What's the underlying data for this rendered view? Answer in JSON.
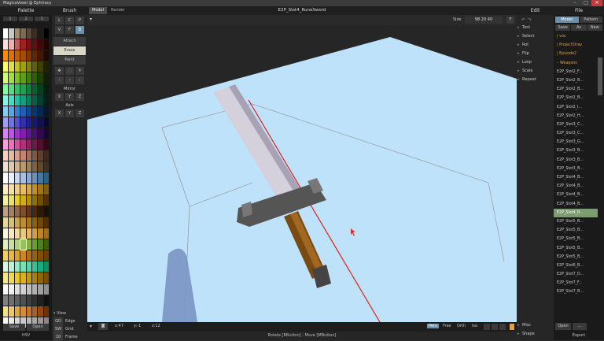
{
  "window": {
    "title": "MagicaVoxel @ Ephtracy",
    "controls": [
      "–",
      "□",
      "✕"
    ]
  },
  "palette": {
    "header": "Palette",
    "tabs": [
      "1",
      "2",
      "3"
    ],
    "save_label": "Save",
    "open_label": "Open",
    "footer": "HSV",
    "selected_index": "swatch selected",
    "colors": [
      "#ffffff",
      "#c8c8c8",
      "#a08c6c",
      "#7a6a56",
      "#584838",
      "#3a2e24",
      "#1e1a14",
      "#000000",
      "#ffe0e0",
      "#f0b0b0",
      "#c06060",
      "#a02020",
      "#801010",
      "#601010",
      "#400808",
      "#200404",
      "#ff8c00",
      "#e07000",
      "#c06000",
      "#a05000",
      "#803800",
      "#602800",
      "#401800",
      "#200800",
      "#ffff70",
      "#e0e040",
      "#c0c020",
      "#a0a010",
      "#808010",
      "#606008",
      "#404004",
      "#202000",
      "#d0ff70",
      "#a0e040",
      "#80c020",
      "#60a010",
      "#408008",
      "#306004",
      "#204000",
      "#102000",
      "#80ffa0",
      "#50e080",
      "#30c060",
      "#20a050",
      "#108040",
      "#086030",
      "#044020",
      "#022010",
      "#80ffe0",
      "#40e0c0",
      "#20c0a0",
      "#10a080",
      "#088060",
      "#066048",
      "#044030",
      "#022018",
      "#80d0ff",
      "#50a8f0",
      "#3080d0",
      "#2060b0",
      "#104890",
      "#083870",
      "#042850",
      "#021830",
      "#a0a0ff",
      "#7070f0",
      "#5050d0",
      "#3030b0",
      "#202090",
      "#181870",
      "#101050",
      "#080830",
      "#e080ff",
      "#c050f0",
      "#a030d0",
      "#8020b0",
      "#601890",
      "#481070",
      "#300850",
      "#180430",
      "#ffa0e0",
      "#f070c0",
      "#d050a0",
      "#b03080",
      "#902060",
      "#701848",
      "#501030",
      "#300818",
      "#f8d0c0",
      "#e8b8a0",
      "#d8a088",
      "#c08870",
      "#a07058",
      "#805840",
      "#604030",
      "#402820",
      "#f0e0d0",
      "#e0c8b0",
      "#d0b090",
      "#b89870",
      "#a08058",
      "#806040",
      "#604830",
      "#403020",
      "#ffffff",
      "#e8f0ff",
      "#c8d8f0",
      "#a8c0e0",
      "#88a8d0",
      "#6890c0",
      "#4878a0",
      "#306080",
      "#fff0c0",
      "#f8e0a0",
      "#f0d080",
      "#e8c060",
      "#d8a840",
      "#c09028",
      "#a07818",
      "#806010",
      "#f8f0a0",
      "#f0e060",
      "#e8d020",
      "#d0b010",
      "#b09008",
      "#907004",
      "#705002",
      "#503000",
      "#c0a080",
      "#a88060",
      "#906848",
      "#785030",
      "#603820",
      "#482810",
      "#301808",
      "#181000",
      "#e8d8a0",
      "#d8c070",
      "#c8a850",
      "#b89030",
      "#a07820",
      "#886010",
      "#704808",
      "#503000",
      "#fff8e0",
      "#f8e8c0",
      "#f0d8a0",
      "#e8c880",
      "#e0b860",
      "#d0a040",
      "#b88828",
      "#a07018",
      "#e0f0c0",
      "#c8e0a0",
      "#b0d080",
      "#98c060",
      "#80b040",
      "#68a030",
      "#508020",
      "#386010",
      "#f0d060",
      "#e8b840",
      "#d8a030",
      "#c88820",
      "#b07018",
      "#986010",
      "#805008",
      "#684000",
      "#d8f8e8",
      "#b8f0d8",
      "#98e8c8",
      "#78e0b8",
      "#58d0a8",
      "#38c098",
      "#20a880",
      "#109068",
      "#f8e880",
      "#f0d850",
      "#e8c830",
      "#d8b020",
      "#c09818",
      "#a88010",
      "#906808",
      "#785000",
      "#ffffff",
      "#f0f0f0",
      "#e0e0e0",
      "#d0d0d0",
      "#c0c0c0",
      "#b0b0b0",
      "#a0a0a0",
      "#909090",
      "#808080",
      "#707070",
      "#606060",
      "#505050",
      "#404040",
      "#303030",
      "#202020",
      "#101010",
      "#fbe080",
      "#f0c860",
      "#e0a848",
      "#d09038",
      "#c07828",
      "#a86020",
      "#904818",
      "#703010",
      "#f8f8f8",
      "#e8e8e8",
      "#d8d8d8",
      "#c8c8c8",
      "#b8b8b8",
      "#a8a8a8",
      "#989898",
      "#888888"
    ]
  },
  "brush": {
    "header": "Brush",
    "types": [
      "L",
      "C",
      "P",
      "V",
      "F",
      "B"
    ],
    "modes": [
      "Attach",
      "Erase",
      "Paint"
    ],
    "mirror_label": "Mirror",
    "axis_label": "Axis",
    "xyz": [
      "X",
      "Y",
      "Z"
    ],
    "view_label": "View",
    "view_rows": [
      {
        "key": "GD",
        "label": "Edge"
      },
      {
        "key": "SW",
        "label": "Grid"
      },
      {
        "key": "10",
        "label": "Frame"
      }
    ]
  },
  "viewport": {
    "tabs": [
      "Model",
      "Render"
    ],
    "filename": "E2P_Slot4_RuneSword",
    "size_label": "Size",
    "size_values": "98  20  40",
    "flip": "F",
    "status": {
      "x": "x:47",
      "y": "y:-1",
      "z": "z:12",
      "views": [
        "Pers",
        "Free",
        "Orth",
        "Iso"
      ]
    },
    "hint": "Rotate [RButton] : Move [MButton]"
  },
  "tools": {
    "header": "Edit",
    "items": [
      "Tool",
      "Select",
      "Rot",
      "Flip",
      "Loop",
      "Scale",
      "Repeat"
    ],
    "misc": "Misc",
    "shape": "Shape"
  },
  "files": {
    "header": "File",
    "tabs": [
      "Model",
      "Pattern"
    ],
    "actions": [
      "Save",
      "As",
      "New"
    ],
    "folders": [
      "vox",
      "ProjectStray",
      "Episode2",
      "Weapons"
    ],
    "items": [
      "E2P_Slot2_F...",
      "E2P_Slot2_B...",
      "E2P_Slot2_B...",
      "E2P_Slot2_B...",
      "E2P_Slot2_I...",
      "E2P_Slot2_H...",
      "E2P_Slot3_C...",
      "E2P_Slot3_C...",
      "E2P_Slot3_G...",
      "E2P_Slot3_B...",
      "E2P_Slot3_B...",
      "E2P_Slot3_B...",
      "E2P_Slot4_B...",
      "E2P_Slot4_B...",
      "E2P_Slot4_B...",
      "E2P_Slot4_B...",
      "E2P_Slot4_R...",
      "E2P_Slot5_B...",
      "E2P_Slot5_B...",
      "E2P_Slot5_B...",
      "E2P_Slot5_B...",
      "E2P_Slot5_B...",
      "E2P_Slot6_B...",
      "E2P_Slot7_D...",
      "E2P_Slot7_F...",
      "E2P_Slot7_B..."
    ],
    "open_label": "Open",
    "more_label": "...",
    "export_label": "Export"
  }
}
